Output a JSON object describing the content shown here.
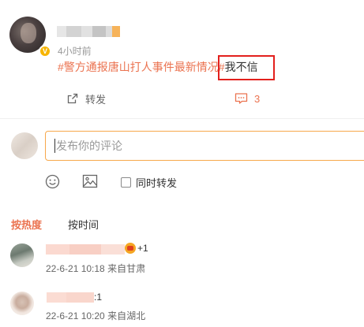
{
  "post": {
    "author_name": "",
    "time": "4小时前",
    "verified_badge": "V",
    "topic": "#警方通报唐山打人事件最新情况#",
    "text": "我不信",
    "actions": {
      "forward_label": "转发",
      "comment_count": "3"
    },
    "highlight_color": "#e3201d"
  },
  "composer": {
    "placeholder": "发布你的评论",
    "repost_label": "同时转发",
    "repost_checked": false,
    "border_color": "#f7a84b"
  },
  "sort_tabs": [
    {
      "label": "按热度",
      "active": true
    },
    {
      "label": "按时间",
      "active": false
    }
  ],
  "comments": [
    {
      "author_name": "",
      "text": "+1",
      "has_badge": true,
      "date": "22-6-21 10:18",
      "location": "来自甘肃"
    },
    {
      "author_name": "",
      "text": ":1",
      "has_badge": false,
      "date": "22-6-21 10:20",
      "location": "来自湖北"
    }
  ],
  "colors": {
    "accent": "#eb7350",
    "text": "#333333",
    "muted": "#999999"
  }
}
